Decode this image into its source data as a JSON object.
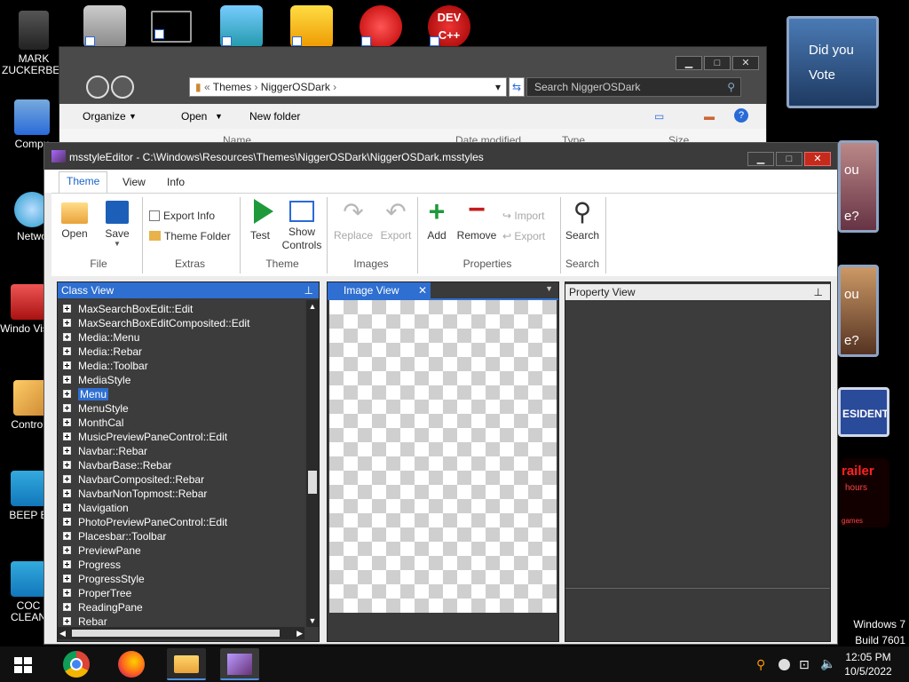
{
  "desktop": {
    "icons": [
      {
        "label": "MARK ZUCKERBERG"
      },
      {
        "label": "Compu"
      },
      {
        "label": "Netwo"
      },
      {
        "label": "Windo Vista"
      },
      {
        "label": "Control I"
      },
      {
        "label": "BEEP B"
      },
      {
        "label": "COC CLEAN"
      }
    ],
    "gadgets": {
      "photo_text": "Did you Vote",
      "side_text_1": "ou",
      "side_text_2": "e?",
      "side_text_3": "ou",
      "side_text_4": "e?",
      "president": "ESIDENT",
      "trailer": "railer",
      "trailer_sub": "hours",
      "trailer_small": "games"
    },
    "watermark": {
      "line1": "Windows 7",
      "line2": "Build 7601"
    }
  },
  "explorer": {
    "breadcrumb": [
      "Themes",
      "NiggerOSDark"
    ],
    "search_placeholder": "Search NiggerOSDark",
    "commands": {
      "organize": "Organize",
      "open": "Open",
      "new_folder": "New folder"
    },
    "columns": [
      "Name",
      "Date modified",
      "Type",
      "Size"
    ]
  },
  "editor": {
    "title": "msstyleEditor - C:\\Windows\\Resources\\Themes\\NiggerOSDark\\NiggerOSDark.msstyles",
    "tabs": [
      "Theme",
      "View",
      "Info"
    ],
    "ribbon": {
      "open": "Open",
      "save": "Save",
      "export_info": "Export Info",
      "theme_folder": "Theme Folder",
      "test": "Test",
      "show_controls_1": "Show",
      "show_controls_2": "Controls",
      "replace": "Replace",
      "export": "Export",
      "add": "Add",
      "remove": "Remove",
      "import_small": "Import",
      "export_small": "Export",
      "search": "Search",
      "groups": {
        "file": "File",
        "extras": "Extras",
        "theme": "Theme",
        "images": "Images",
        "properties": "Properties",
        "search": "Search"
      }
    },
    "class_view": {
      "title": "Class View",
      "items": [
        "MaxSearchBoxEdit::Edit",
        "MaxSearchBoxEditComposited::Edit",
        "Media::Menu",
        "Media::Rebar",
        "Media::Toolbar",
        "MediaStyle",
        "Menu",
        "MenuStyle",
        "MonthCal",
        "MusicPreviewPaneControl::Edit",
        "Navbar::Rebar",
        "NavbarBase::Rebar",
        "NavbarComposited::Rebar",
        "NavbarNonTopmost::Rebar",
        "Navigation",
        "PhotoPreviewPaneControl::Edit",
        "Placesbar::Toolbar",
        "PreviewPane",
        "Progress",
        "ProgressStyle",
        "ProperTree",
        "ReadingPane",
        "Rebar"
      ],
      "selected": "Menu"
    },
    "image_view": {
      "title": "Image View"
    },
    "property_view": {
      "title": "Property View"
    }
  },
  "taskbar": {
    "time": "12:05 PM",
    "date": "10/5/2022"
  },
  "colors": {
    "accent": "#1a64c8",
    "selection": "#2e6fd1",
    "panel_bg": "#3c3c3c",
    "title_bar": "#3b3b3b",
    "close_red": "#c42b1c"
  }
}
